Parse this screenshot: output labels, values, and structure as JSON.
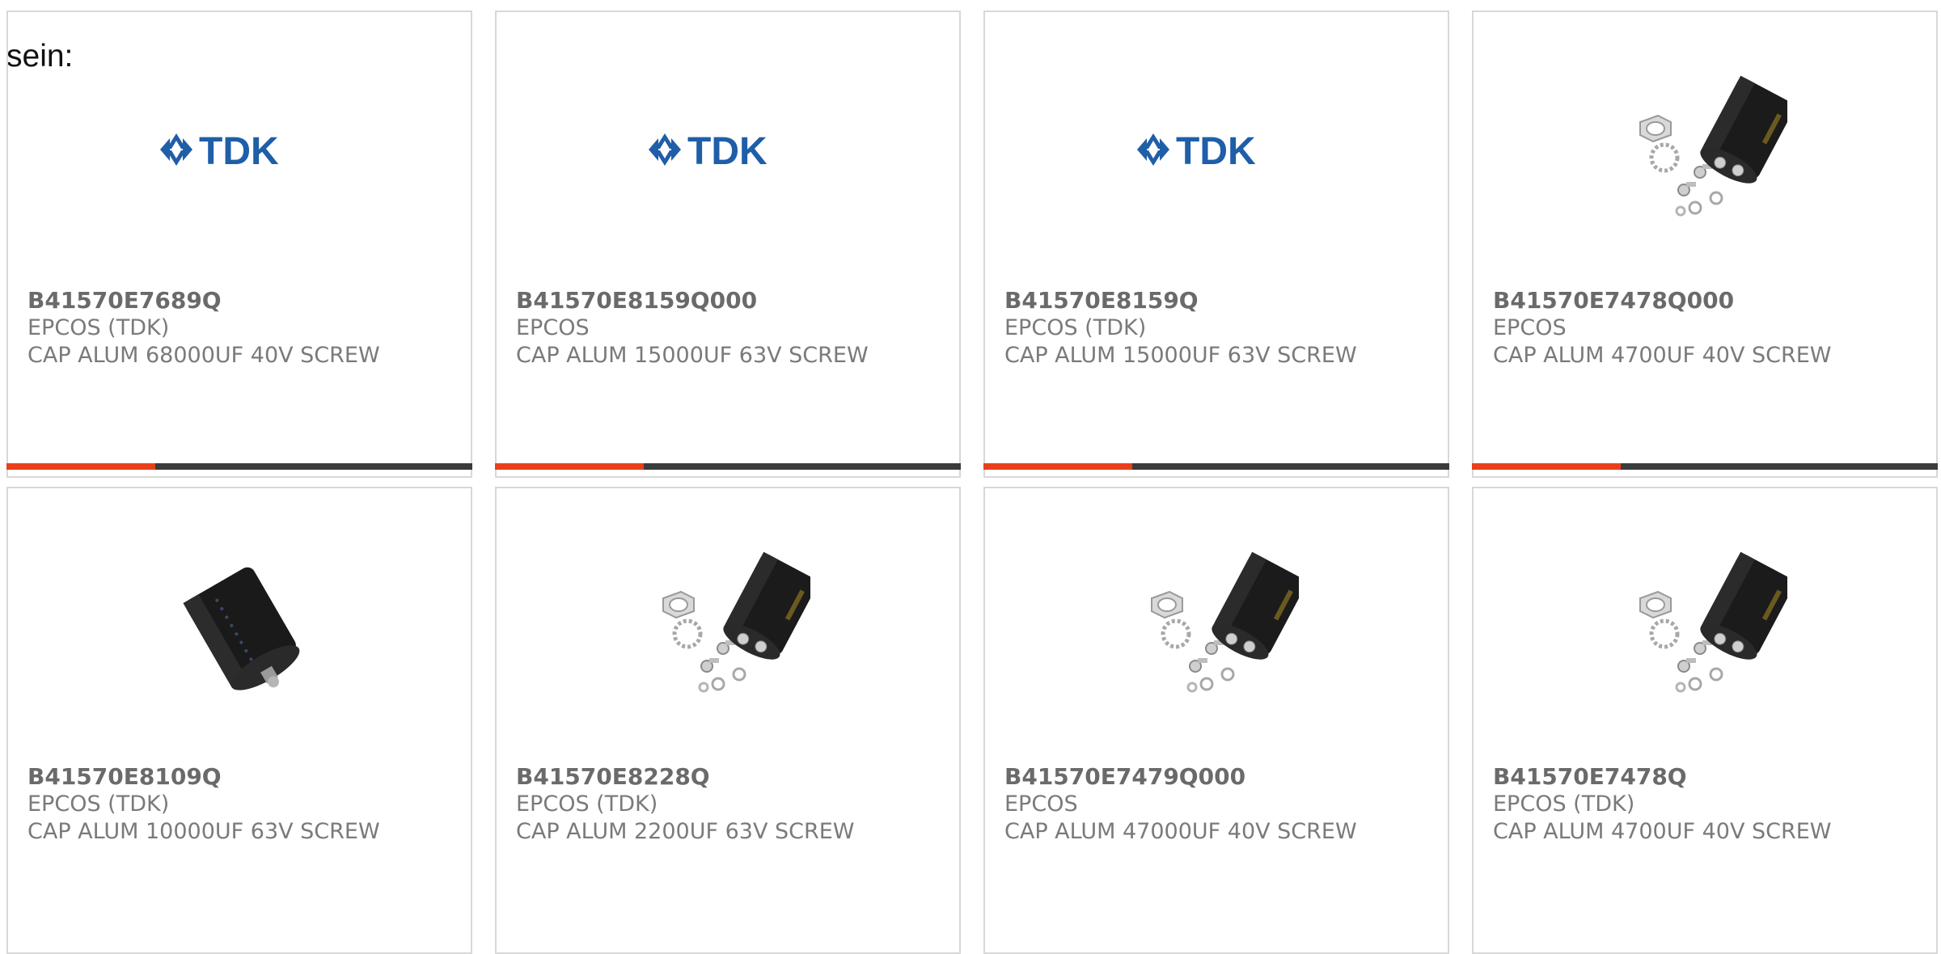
{
  "intro_text": "sein:",
  "colors": {
    "accent": "#e8401c",
    "bar_dark": "#3b3b3b",
    "tdk_blue": "#1f5ea8",
    "card_border": "#d8d8d8"
  },
  "products": [
    {
      "part_number": "B41570E7689Q",
      "manufacturer": "EPCOS (TDK)",
      "description": "CAP ALUM 68000UF 40V SCREW",
      "image": "tdk-logo",
      "logo_text": "TDK"
    },
    {
      "part_number": "B41570E8159Q000",
      "manufacturer": "EPCOS",
      "description": "CAP ALUM 15000UF 63V SCREW",
      "image": "tdk-logo",
      "logo_text": "TDK"
    },
    {
      "part_number": "B41570E8159Q",
      "manufacturer": "EPCOS (TDK)",
      "description": "CAP ALUM 15000UF 63V SCREW",
      "image": "tdk-logo",
      "logo_text": "TDK"
    },
    {
      "part_number": "B41570E7478Q000",
      "manufacturer": "EPCOS",
      "description": "CAP ALUM 4700UF 40V SCREW",
      "image": "capacitor-with-hardware"
    },
    {
      "part_number": "B41570E8109Q",
      "manufacturer": "EPCOS (TDK)",
      "description": "CAP ALUM 10000UF 63V SCREW",
      "image": "capacitor-side-view"
    },
    {
      "part_number": "B41570E8228Q",
      "manufacturer": "EPCOS (TDK)",
      "description": "CAP ALUM 2200UF 63V SCREW",
      "image": "capacitor-with-hardware"
    },
    {
      "part_number": "B41570E7479Q000",
      "manufacturer": "EPCOS",
      "description": "CAP ALUM 47000UF 40V SCREW",
      "image": "capacitor-with-hardware"
    },
    {
      "part_number": "B41570E7478Q",
      "manufacturer": "EPCOS (TDK)",
      "description": "CAP ALUM 4700UF 40V SCREW",
      "image": "capacitor-with-hardware"
    }
  ]
}
